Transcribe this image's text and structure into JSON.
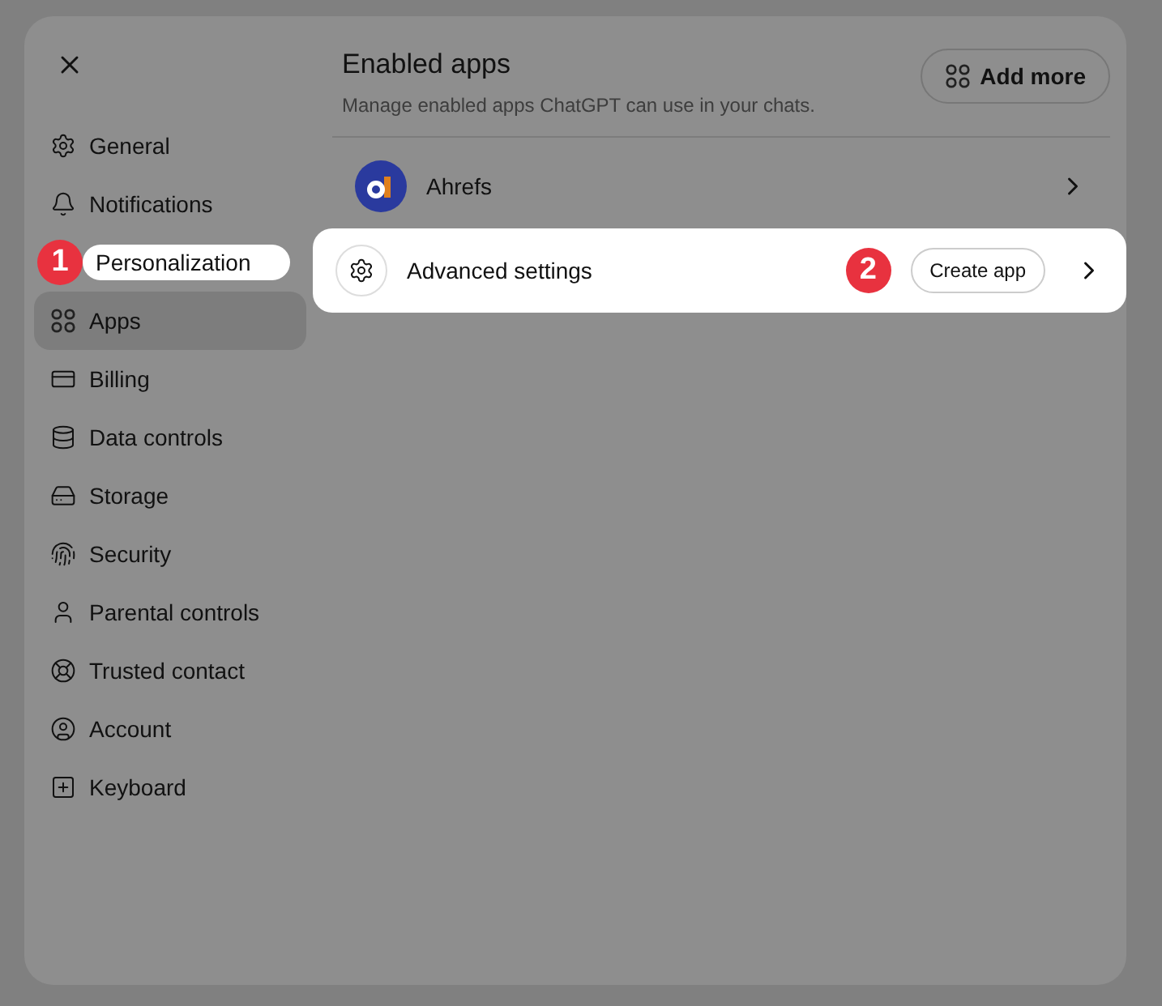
{
  "sidebar": {
    "items": [
      {
        "label": "General",
        "selected": false,
        "highlighted": false
      },
      {
        "label": "Notifications",
        "selected": false,
        "highlighted": false
      },
      {
        "label": "Personalization",
        "selected": false,
        "highlighted": true,
        "callout": "1"
      },
      {
        "label": "Apps",
        "selected": true,
        "highlighted": false
      },
      {
        "label": "Billing",
        "selected": false,
        "highlighted": false
      },
      {
        "label": "Data controls",
        "selected": false,
        "highlighted": false
      },
      {
        "label": "Storage",
        "selected": false,
        "highlighted": false
      },
      {
        "label": "Security",
        "selected": false,
        "highlighted": false
      },
      {
        "label": "Parental controls",
        "selected": false,
        "highlighted": false
      },
      {
        "label": "Trusted contact",
        "selected": false,
        "highlighted": false
      },
      {
        "label": "Account",
        "selected": false,
        "highlighted": false
      },
      {
        "label": "Keyboard",
        "selected": false,
        "highlighted": false
      }
    ]
  },
  "header": {
    "title": "Enabled apps",
    "description": "Manage enabled apps ChatGPT can use in your chats.",
    "button": "Add more"
  },
  "apps": [
    {
      "name": "Ahrefs"
    }
  ],
  "advanced": {
    "label": "Advanced settings",
    "button": "Create app",
    "highlighted": true,
    "callout": "2"
  }
}
